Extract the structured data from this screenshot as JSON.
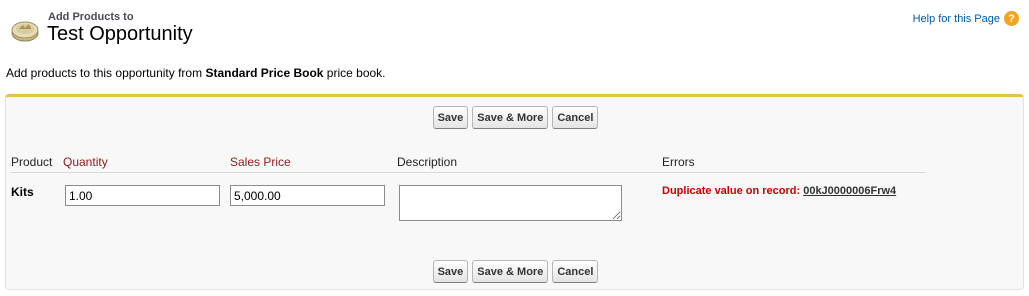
{
  "header": {
    "kicker": "Add Products to",
    "title": "Test Opportunity",
    "help_link": "Help for this Page",
    "help_icon": "?"
  },
  "intro": {
    "prefix": "Add products to this opportunity from ",
    "price_book": "Standard Price Book",
    "suffix": " price book."
  },
  "buttons": {
    "save": "Save",
    "save_more": "Save & More",
    "cancel": "Cancel"
  },
  "table": {
    "columns": {
      "product": "Product",
      "quantity": "Quantity",
      "sales_price": "Sales Price",
      "description": "Description",
      "errors": "Errors"
    },
    "rows": [
      {
        "product": "Kits",
        "quantity": "1.00",
        "sales_price": "5,000.00",
        "description": "",
        "error_text": "Duplicate value on record: ",
        "error_link": "00kJ0000006Frw4"
      }
    ]
  },
  "colors": {
    "accent_border": "#e8c04a",
    "required_label": "#8a1a1a",
    "error": "#cc0000",
    "link": "#015ba7"
  }
}
